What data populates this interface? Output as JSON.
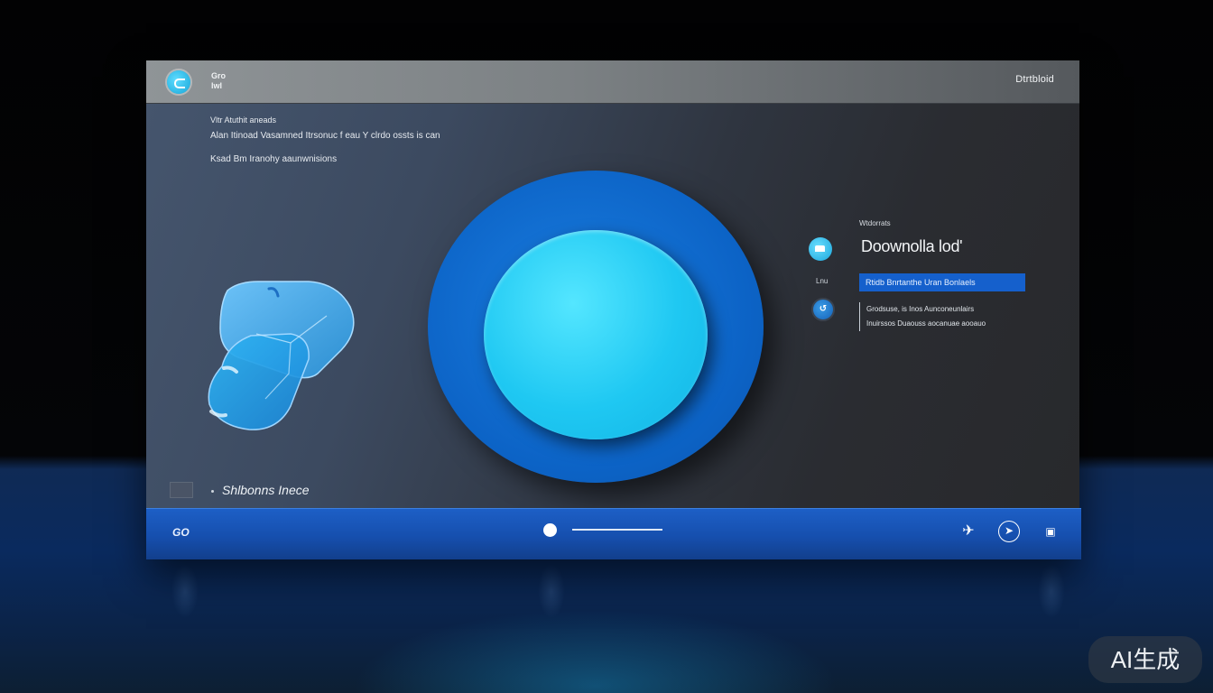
{
  "window": {
    "title_logo": [
      "Gro",
      "lwl"
    ],
    "title_right": "Dtrtbloid"
  },
  "info": {
    "line1": "Vltr Atuthit aneads",
    "line2": "Alan Itinoad Vasamned Itrsonuc f eau Y clrdo ossts is can",
    "line3": "Ksad Bm Iranohy aaunwnisions"
  },
  "download_panel": {
    "small_label": "Wtdorrats",
    "title": "Doownolla lod'",
    "field_label": "Lnu",
    "url_value": "Rtidb Bnrtanthe Uran Bonlaels",
    "link_icon_glyph": "↺",
    "desc_lines": [
      "Grodsuse, is Inos Aunconeunlairs",
      "Inuirssos Duaouss aocanuae aooauo"
    ]
  },
  "footer": {
    "text": "Shlbonns Inece"
  },
  "controlbar": {
    "left_label": "GO",
    "slider_position": 0,
    "icons": [
      "plane-icon",
      "compass-icon",
      "image-icon"
    ]
  },
  "colors": {
    "accent": "#1560cc",
    "button": "#1fc8f2",
    "ring": "#0c63c6"
  },
  "watermark": "AI生成"
}
